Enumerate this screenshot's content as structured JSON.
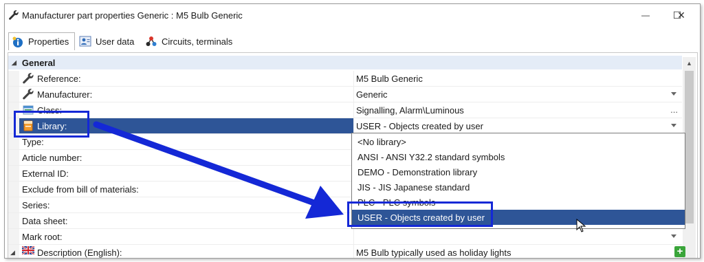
{
  "window": {
    "title": "Manufacturer part properties Generic : M5 Bulb Generic",
    "minimize_glyph": "—",
    "maximize_glyph": "☐",
    "close_glyph": "✕"
  },
  "tabs": [
    {
      "label": "Properties",
      "icon": "info-icon",
      "active": true
    },
    {
      "label": "User data",
      "icon": "user-card-icon",
      "active": false
    },
    {
      "label": "Circuits, terminals",
      "icon": "circuits-icon",
      "active": false
    }
  ],
  "category": {
    "label": "General",
    "expanded_glyph": "◢"
  },
  "rows": [
    {
      "name": "Reference:",
      "value": "M5 Bulb Generic",
      "icon": "wrench-icon"
    },
    {
      "name": "Manufacturer:",
      "value": "Generic",
      "icon": "wrench-icon",
      "dropdown": true
    },
    {
      "name": "Class:",
      "value": "Signalling, Alarm\\Luminous",
      "icon": "class-icon",
      "ellipsis": "..."
    },
    {
      "name": "Library:",
      "value": "USER - Objects created by user",
      "icon": "library-icon",
      "dropdown": true,
      "selected": true
    },
    {
      "name": "Type:",
      "value": ""
    },
    {
      "name": "Article number:",
      "value": ""
    },
    {
      "name": "External ID:",
      "value": ""
    },
    {
      "name": "Exclude from bill of materials:",
      "value": ""
    },
    {
      "name": "Series:",
      "value": ""
    },
    {
      "name": "Data sheet:",
      "value": ""
    },
    {
      "name": "Mark root:",
      "value": ""
    },
    {
      "name": "Description (English):",
      "value": "M5 Bulb typically used as holiday lights",
      "icon": "uk-flag-icon",
      "expand": true
    }
  ],
  "library_options": [
    {
      "label": "<No library>"
    },
    {
      "label": "ANSI - ANSI Y32.2 standard symbols"
    },
    {
      "label": "DEMO - Demonstration library"
    },
    {
      "label": "JIS - JIS Japanese standard"
    },
    {
      "label": "PLC - PLC symbols"
    },
    {
      "label": "USER - Objects created by user",
      "selected": true
    }
  ],
  "add_button_glyph": "+",
  "colors": {
    "selection": "#2e5597",
    "category_bg": "#e4ecf7",
    "annotation": "#1428d6",
    "add_button": "#3aa53a"
  }
}
